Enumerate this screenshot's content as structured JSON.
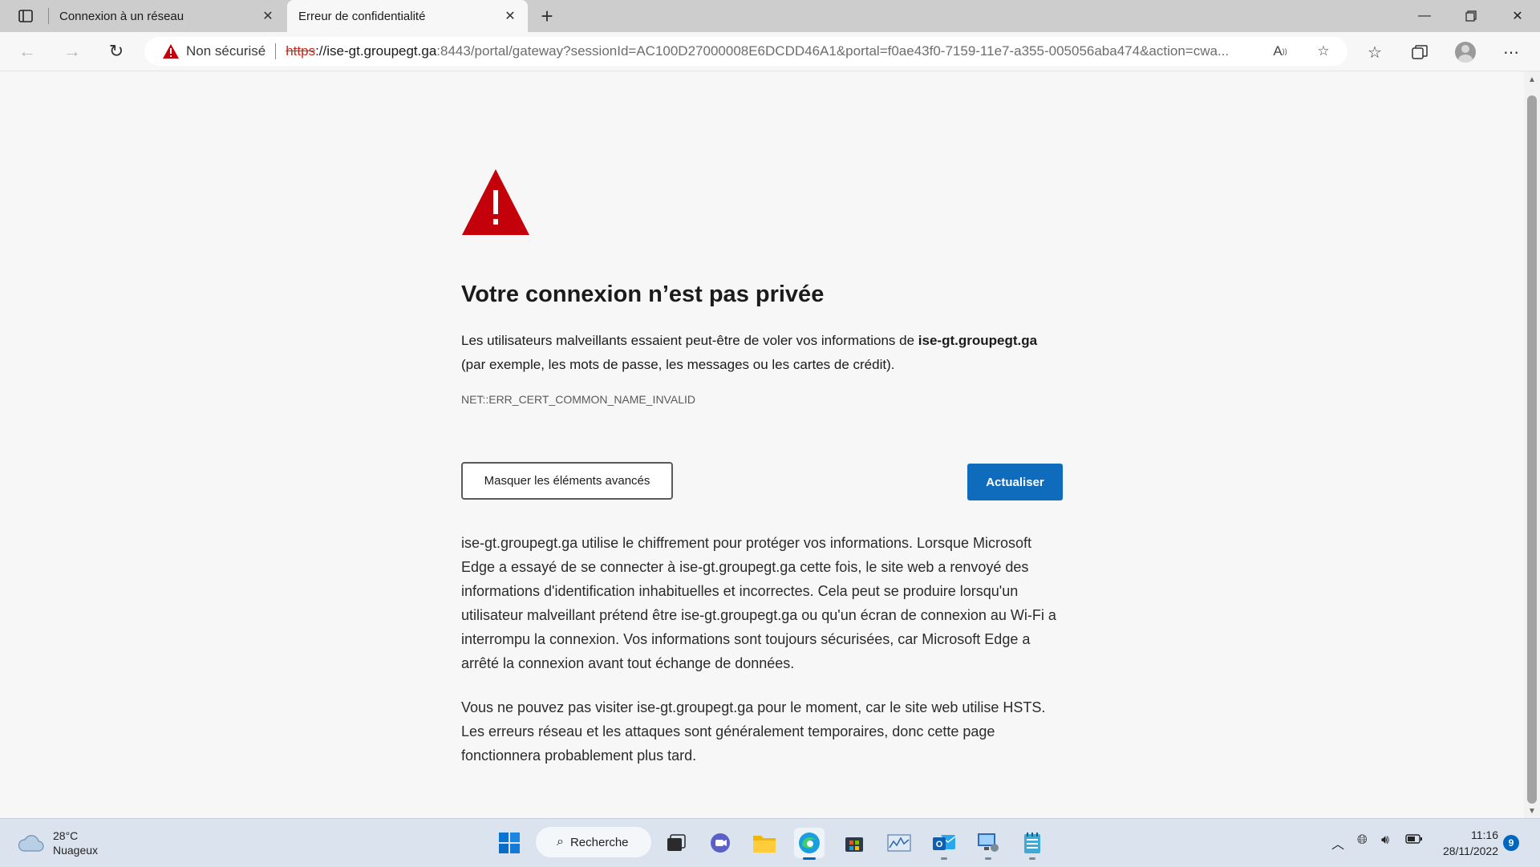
{
  "browser": {
    "tabs": [
      {
        "title": "Connexion à un réseau",
        "active": false
      },
      {
        "title": "Erreur de confidentialité",
        "active": true
      }
    ],
    "security_label": "Non sécurisé",
    "url": {
      "scheme": "https",
      "host": "ise-gt.groupegt.ga",
      "rest": ":8443/portal/gateway?sessionId=AC100D27000008E6DCDD46A1&portal=f0ae43f0-7159-11e7-a355-005056aba474&action=cwa..."
    }
  },
  "page": {
    "heading": "Votre connexion n’est pas privée",
    "desc_pre": "Les utilisateurs malveillants essaient peut-être de voler vos informations de ",
    "desc_host": "ise-gt.groupegt.ga",
    "desc_post": " (par exemple, les mots de passe, les messages ou les cartes de crédit).",
    "error_code": "NET::ERR_CERT_COMMON_NAME_INVALID",
    "advanced_button": "Masquer les éléments avancés",
    "refresh_button": "Actualiser",
    "paragraph1": "ise-gt.groupegt.ga utilise le chiffrement pour protéger vos informations. Lorsque Microsoft Edge a essayé de se connecter à ise-gt.groupegt.ga cette fois, le site web a renvoyé des informations d'identification inhabituelles et incorrectes. Cela peut se produire lorsqu'un utilisateur malveillant prétend être ise-gt.groupegt.ga ou qu'un écran de connexion au Wi-Fi a interrompu la connexion. Vos informations sont toujours sécurisées, car Microsoft Edge a arrêté la connexion avant tout échange de données.",
    "paragraph2": "Vous ne pouvez pas visiter ise-gt.groupegt.ga pour le moment, car le site web utilise HSTS. Les erreurs réseau et les attaques sont généralement temporaires, donc cette page fonctionnera probablement plus tard."
  },
  "taskbar": {
    "weather_temp": "28°C",
    "weather_desc": "Nuageux",
    "search_label": "Recherche",
    "time": "11:16",
    "date": "28/11/2022",
    "notification_count": "9"
  },
  "colors": {
    "warning_red": "#c4000a",
    "accent_blue": "#0f6cbd"
  }
}
